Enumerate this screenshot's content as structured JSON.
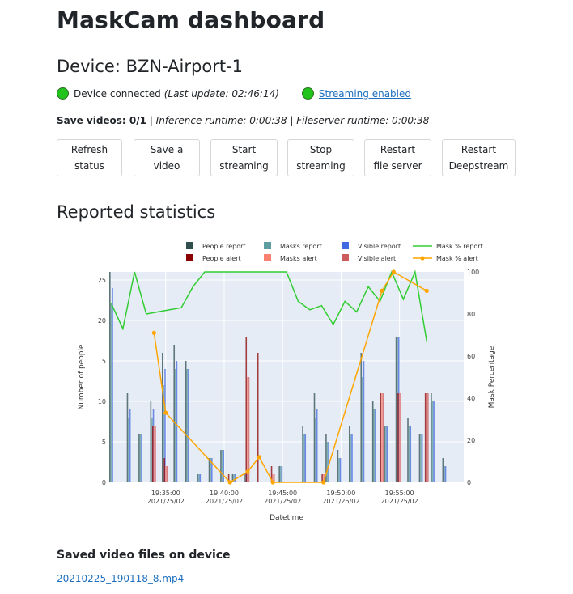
{
  "page_title": "MaskCam dashboard",
  "device_heading": "Device: BZN-Airport-1",
  "status": {
    "connected_text": "Device connected",
    "last_update": "(Last update: 02:46:14)",
    "streaming_link": "Streaming enabled",
    "indicator_color": "#22c31a"
  },
  "runtime": {
    "save_videos_label": "Save videos: 0/1",
    "separator": " | ",
    "inference": "Inference runtime: 0:00:38",
    "fileserver": "Fileserver runtime: 0:00:38"
  },
  "buttons": [
    {
      "label": "Refresh status",
      "line1": "Refresh",
      "line2": "status"
    },
    {
      "label": "Save a video",
      "line1": "Save a",
      "line2": "video"
    },
    {
      "label": "Start streaming",
      "line1": "Start",
      "line2": "streaming"
    },
    {
      "label": "Stop streaming",
      "line1": "Stop",
      "line2": "streaming"
    },
    {
      "label": "Restart file server",
      "line1": "Restart",
      "line2": "file server"
    },
    {
      "label": "Restart Deepstream",
      "line1": "Restart",
      "line2": "Deepstream"
    }
  ],
  "stats_heading": "Reported statistics",
  "chart_data": {
    "type": "bar",
    "xlabel": "Datetime",
    "ylabel": "Number of people",
    "ylabel2": "Mask Percentage",
    "ylim": [
      0,
      26
    ],
    "y2lim": [
      0,
      100
    ],
    "yticks": [
      0,
      5,
      10,
      15,
      20,
      25
    ],
    "y2ticks": [
      0,
      20,
      40,
      60,
      80,
      100
    ],
    "xlim": [
      "19:30:10",
      "20:00:30"
    ],
    "xticks": [
      {
        "t": "19:35:00",
        "l1": "19:35:00",
        "l2": "2021/25/02"
      },
      {
        "t": "19:40:00",
        "l1": "19:40:00",
        "l2": "2021/25/02"
      },
      {
        "t": "19:45:00",
        "l1": "19:45:00",
        "l2": "2021/25/02"
      },
      {
        "t": "19:50:00",
        "l1": "19:50:00",
        "l2": "2021/25/02"
      },
      {
        "t": "19:55:00",
        "l1": "19:55:00",
        "l2": "2021/25/02"
      }
    ],
    "legend": [
      {
        "name": "People report",
        "kind": "bar",
        "color": "#2f4f4f"
      },
      {
        "name": "Masks report",
        "kind": "bar",
        "color": "#5f9ea0"
      },
      {
        "name": "Visible report",
        "kind": "bar",
        "color": "#4169e1"
      },
      {
        "name": "Mask % report",
        "kind": "line",
        "color": "#32cd32"
      },
      {
        "name": "People alert",
        "kind": "bar",
        "color": "#8b0000"
      },
      {
        "name": "Masks alert",
        "kind": "bar",
        "color": "#fa8072"
      },
      {
        "name": "Visible alert",
        "kind": "bar",
        "color": "#cd5c5c"
      },
      {
        "name": "Mask % alert",
        "kind": "line-marker",
        "color": "#ffa500"
      }
    ],
    "report_bars": [
      {
        "t": "19:30:20",
        "people": 26,
        "masks": 22,
        "visible": 24
      },
      {
        "t": "19:30:50",
        "people": 0,
        "masks": 0,
        "visible": 0
      },
      {
        "t": "19:31:50",
        "people": 11,
        "masks": 8,
        "visible": 9
      },
      {
        "t": "19:32:50",
        "people": 6,
        "masks": 6,
        "visible": 6
      },
      {
        "t": "19:33:50",
        "people": 10,
        "masks": 8,
        "visible": 9
      },
      {
        "t": "19:34:50",
        "people": 16,
        "masks": 12,
        "visible": 14
      },
      {
        "t": "19:35:50",
        "people": 17,
        "masks": 14,
        "visible": 15
      },
      {
        "t": "19:36:50",
        "people": 15,
        "masks": 14,
        "visible": 14
      },
      {
        "t": "19:37:50",
        "people": 1,
        "masks": 1,
        "visible": 1
      },
      {
        "t": "19:38:50",
        "people": 3,
        "masks": 3,
        "visible": 3
      },
      {
        "t": "19:39:50",
        "people": 4,
        "masks": 4,
        "visible": 4
      },
      {
        "t": "19:40:50",
        "people": 1,
        "masks": 1,
        "visible": 1
      },
      {
        "t": "19:41:50",
        "people": 1,
        "masks": 1,
        "visible": 1
      },
      {
        "t": "19:44:50",
        "people": 2,
        "masks": 2,
        "visible": 2
      },
      {
        "t": "19:46:50",
        "people": 7,
        "masks": 6,
        "visible": 6
      },
      {
        "t": "19:47:50",
        "people": 11,
        "masks": 8,
        "visible": 9
      },
      {
        "t": "19:48:50",
        "people": 6,
        "masks": 5,
        "visible": 5
      },
      {
        "t": "19:49:50",
        "people": 4,
        "masks": 3,
        "visible": 3
      },
      {
        "t": "19:50:50",
        "people": 7,
        "masks": 6,
        "visible": 6
      },
      {
        "t": "19:51:50",
        "people": 16,
        "masks": 13,
        "visible": 15
      },
      {
        "t": "19:52:50",
        "people": 10,
        "masks": 9,
        "visible": 9
      },
      {
        "t": "19:53:50",
        "people": 7,
        "masks": 7,
        "visible": 7
      },
      {
        "t": "19:54:50",
        "people": 18,
        "masks": 18,
        "visible": 18
      },
      {
        "t": "19:55:50",
        "people": 8,
        "masks": 7,
        "visible": 7
      },
      {
        "t": "19:56:50",
        "people": 6,
        "masks": 6,
        "visible": 6
      },
      {
        "t": "19:57:50",
        "people": 11,
        "masks": 10,
        "visible": 10
      },
      {
        "t": "19:58:50",
        "people": 3,
        "masks": 2,
        "visible": 2
      }
    ],
    "alert_bars": [
      {
        "t": "19:34:00",
        "people": 7,
        "masks": 7,
        "visible": 7
      },
      {
        "t": "19:35:00",
        "people": 3,
        "masks": 2,
        "visible": 2
      },
      {
        "t": "19:40:30",
        "people": 1,
        "masks": 0,
        "visible": 0
      },
      {
        "t": "19:42:00",
        "people": 18,
        "masks": 13,
        "visible": 13
      },
      {
        "t": "19:43:00",
        "people": 16,
        "masks": 0,
        "visible": 0
      },
      {
        "t": "19:44:10",
        "people": 2,
        "masks": 1,
        "visible": 1
      },
      {
        "t": "19:48:30",
        "people": 1,
        "masks": 1,
        "visible": 1
      },
      {
        "t": "19:53:30",
        "people": 11,
        "masks": 11,
        "visible": 11
      },
      {
        "t": "19:55:00",
        "people": 11,
        "masks": 11,
        "visible": 11
      },
      {
        "t": "19:57:20",
        "people": 11,
        "masks": 11,
        "visible": 11
      }
    ],
    "mask_report": [
      {
        "t": "19:30:20",
        "v": 85
      },
      {
        "t": "19:31:20",
        "v": 73
      },
      {
        "t": "19:32:20",
        "v": 100
      },
      {
        "t": "19:33:20",
        "v": 80
      },
      {
        "t": "19:34:20",
        "v": 81
      },
      {
        "t": "19:35:20",
        "v": 82
      },
      {
        "t": "19:36:20",
        "v": 83
      },
      {
        "t": "19:37:20",
        "v": 93
      },
      {
        "t": "19:38:20",
        "v": 100
      },
      {
        "t": "19:39:20",
        "v": 100
      },
      {
        "t": "19:40:20",
        "v": 100
      },
      {
        "t": "19:41:20",
        "v": 100
      },
      {
        "t": "19:42:20",
        "v": 100
      },
      {
        "t": "19:43:20",
        "v": 100
      },
      {
        "t": "19:44:20",
        "v": 100
      },
      {
        "t": "19:45:20",
        "v": 100
      },
      {
        "t": "19:46:20",
        "v": 86
      },
      {
        "t": "19:47:20",
        "v": 82
      },
      {
        "t": "19:48:20",
        "v": 84
      },
      {
        "t": "19:49:20",
        "v": 75
      },
      {
        "t": "19:50:20",
        "v": 86
      },
      {
        "t": "19:51:20",
        "v": 81
      },
      {
        "t": "19:52:20",
        "v": 93
      },
      {
        "t": "19:53:20",
        "v": 86
      },
      {
        "t": "19:54:20",
        "v": 100
      },
      {
        "t": "19:55:20",
        "v": 87
      },
      {
        "t": "19:56:20",
        "v": 100
      },
      {
        "t": "19:57:20",
        "v": 67
      }
    ],
    "mask_alert": [
      {
        "t": "19:34:00",
        "v": 71
      },
      {
        "t": "19:35:00",
        "v": 33
      },
      {
        "t": "19:40:30",
        "v": 0
      },
      {
        "t": "19:42:00",
        "v": 5
      },
      {
        "t": "19:43:00",
        "v": 12
      },
      {
        "t": "19:44:10",
        "v": 0
      },
      {
        "t": "19:48:30",
        "v": 0
      },
      {
        "t": "19:53:30",
        "v": 91
      },
      {
        "t": "19:54:30",
        "v": 100
      },
      {
        "t": "19:57:20",
        "v": 91
      }
    ]
  },
  "saved_videos": {
    "heading": "Saved video files on device",
    "files": [
      "20210225_190118_8.mp4"
    ]
  }
}
